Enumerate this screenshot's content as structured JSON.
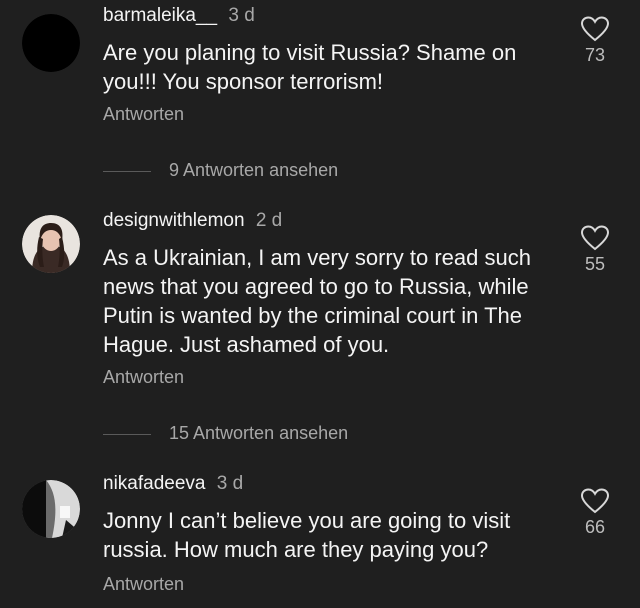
{
  "comments": [
    {
      "username": "barmaleika__",
      "time": "3 d",
      "text": "Are you planing to visit Russia? Shame on you!!! You sponsor terrorism!",
      "likes": "73",
      "reply_label": "Antworten",
      "view_replies": "9 Antworten ansehen"
    },
    {
      "username": "designwithlemon",
      "time": "2 d",
      "text": "As a Ukrainian, I am very sorry to read such news that you agreed to go to Russia, while Putin is wanted by the criminal court in The Hague. Just ashamed of you.",
      "likes": "55",
      "reply_label": "Antworten",
      "view_replies": "15 Antworten ansehen"
    },
    {
      "username": "nikafadeeva",
      "time": "3 d",
      "text": "Jonny I can’t believe you are going to visit russia. How much are they paying you?",
      "likes": "66",
      "reply_label": "Antworten"
    }
  ],
  "colors": {
    "background": "#1f1f1f",
    "primary_text": "#f4f4f4",
    "secondary_text": "#a8a8a8"
  },
  "icons": {
    "like": "heart-outline-icon"
  }
}
